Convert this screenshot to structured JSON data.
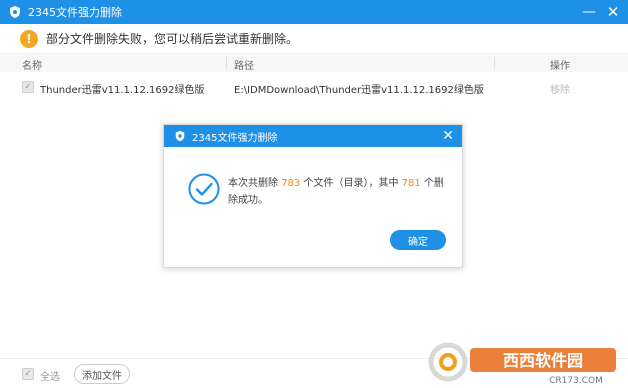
{
  "window": {
    "title": "2345文件强力删除",
    "minimize_glyph": "—",
    "close_glyph": "✕"
  },
  "warning": {
    "icon": "exclamation-icon",
    "text": "部分文件删除失败，您可以稍后尝试重新删除。"
  },
  "table": {
    "headers": {
      "name": "名称",
      "path": "路径",
      "action": "操作"
    },
    "rows": [
      {
        "name": "Thunder迅雷v11.1.12.1692绿色版",
        "path": "E:\\IDMDownload\\Thunder迅雷v11.1.12.1692绿色版",
        "action": "移除"
      }
    ]
  },
  "footer": {
    "select_all": "全选",
    "add_file": "添加文件"
  },
  "dialog": {
    "title": "2345文件强力删除",
    "close_glyph": "✕",
    "msg_part1": "本次共删除 ",
    "total": "783",
    "msg_part2": " 个文件（目录），其中 ",
    "success": "781",
    "msg_part3": " 个删除成功。",
    "ok_label": "确定"
  },
  "colors": {
    "accent": "#1e90e6",
    "warning": "#f5a623",
    "highlight_number": "#f08c1a"
  },
  "watermark": {
    "text1": "西西软件园",
    "text2": "CR173.COM"
  }
}
